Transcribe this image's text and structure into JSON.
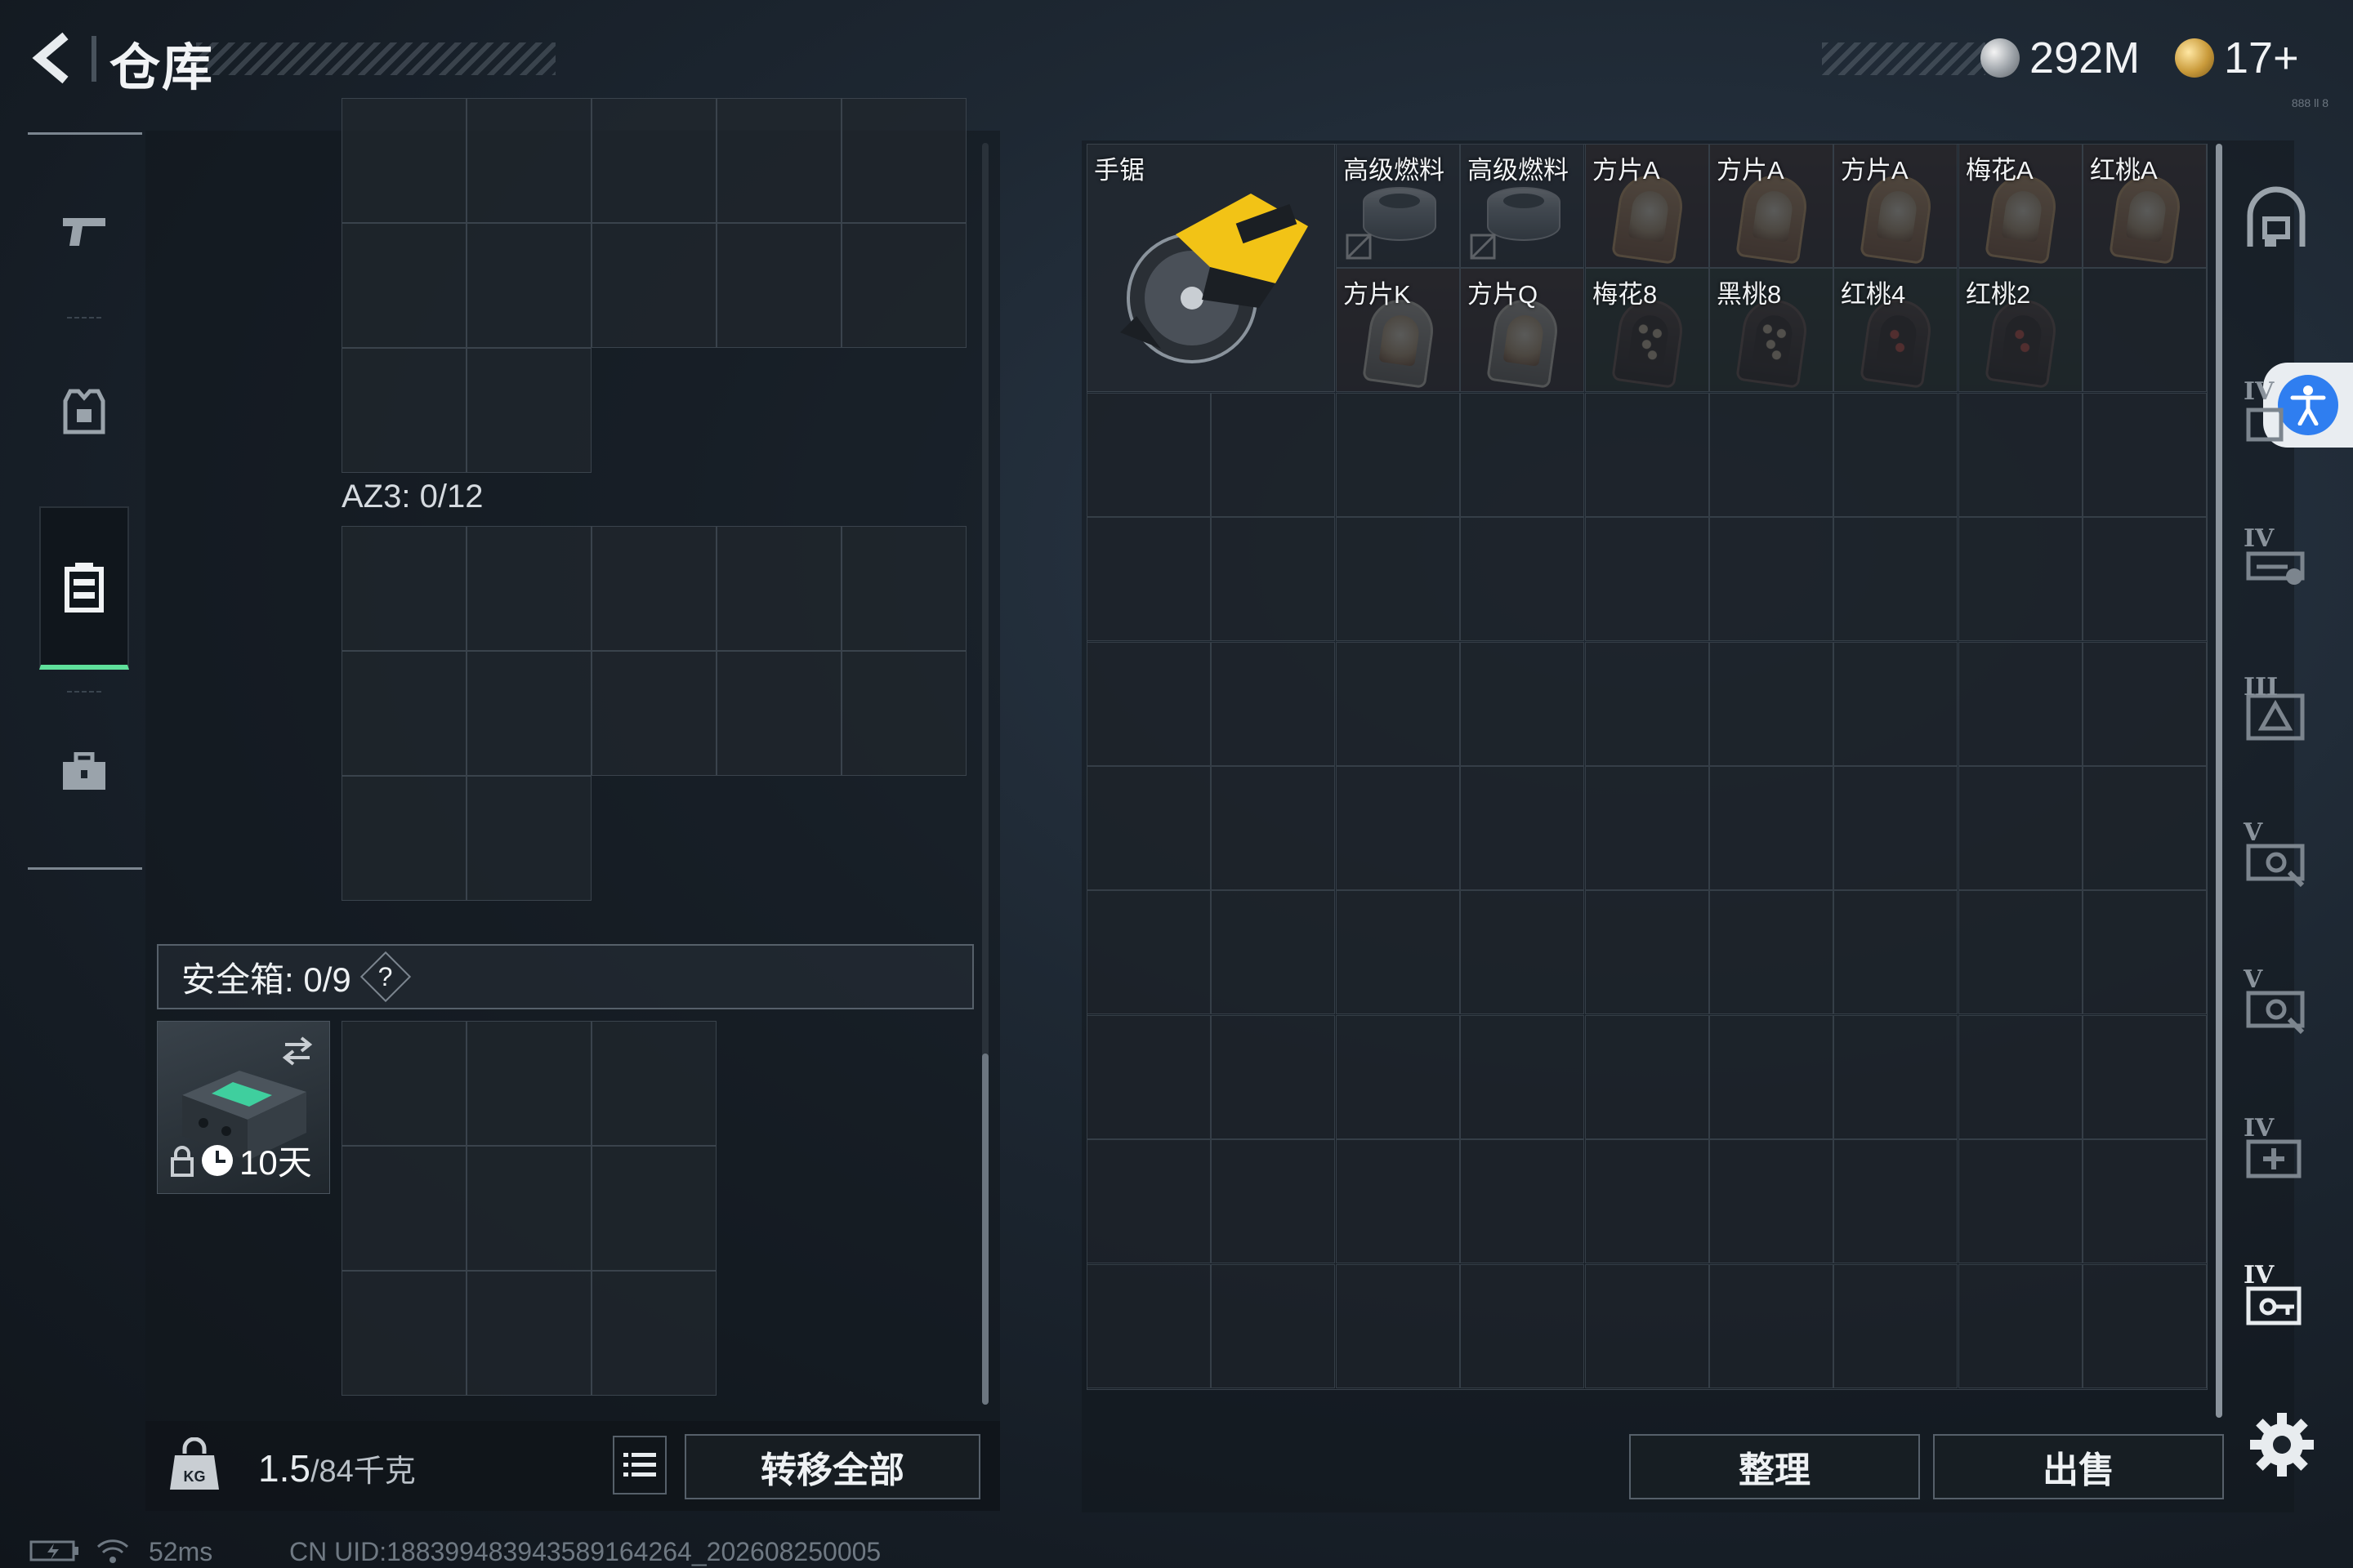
{
  "header": {
    "title": "仓库",
    "currency_silver": "292M",
    "currency_gold": "17+",
    "tiny_meta": "888 ll 8"
  },
  "left": {
    "container_label": "AZ3: 0/12",
    "safe_box": {
      "label": "安全箱: 0/9",
      "help": "?",
      "duration": "10天"
    },
    "weight": {
      "current": "1.5",
      "max": "/84千克"
    },
    "transfer_all": "转移全部"
  },
  "stash": {
    "items": [
      {
        "label": "手锯",
        "kind": "saw"
      },
      {
        "label": "高级燃料",
        "kind": "fuel"
      },
      {
        "label": "高级燃料",
        "kind": "fuel"
      },
      {
        "label": "方片A",
        "kind": "card"
      },
      {
        "label": "方片A",
        "kind": "card"
      },
      {
        "label": "方片A",
        "kind": "card"
      },
      {
        "label": "梅花A",
        "kind": "card"
      },
      {
        "label": "红桃A",
        "kind": "card"
      },
      {
        "label": "方片K",
        "kind": "card-white"
      },
      {
        "label": "方片Q",
        "kind": "card-white"
      },
      {
        "label": "梅花8",
        "kind": "card-dark"
      },
      {
        "label": "黑桃8",
        "kind": "card-dark"
      },
      {
        "label": "红桃4",
        "kind": "card-red"
      },
      {
        "label": "红桃2",
        "kind": "card-red"
      }
    ],
    "sort_button": "整理",
    "sell_button": "出售"
  },
  "rail": {
    "tiers": [
      "IV",
      "IV",
      "III",
      "V",
      "V",
      "IV",
      "IV"
    ]
  },
  "status": {
    "ping": "52ms",
    "uid": "CN UID:1883994839435891642​64_202608250005"
  },
  "colors": {
    "accent_green": "#5fe09b",
    "access_blue": "#2f7ef0"
  }
}
